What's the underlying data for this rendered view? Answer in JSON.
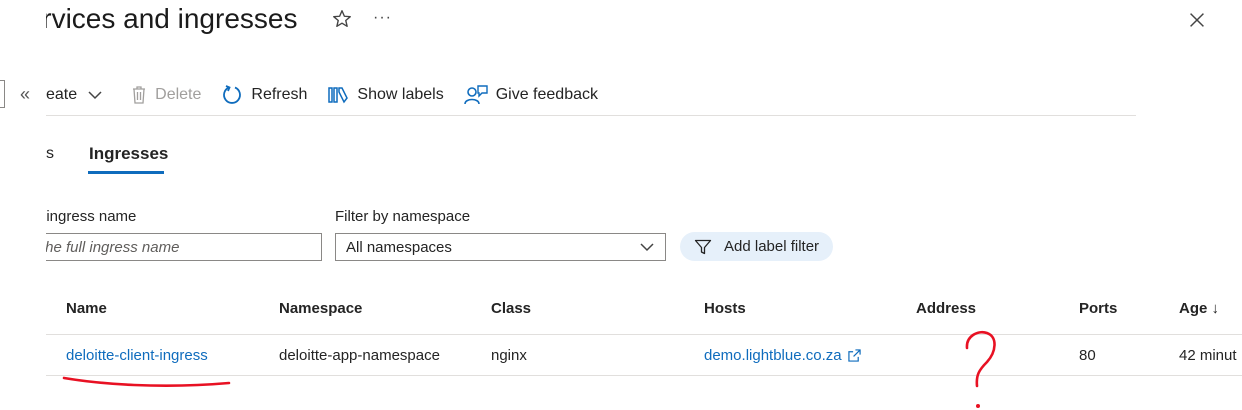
{
  "header": {
    "title": "Services and ingresses",
    "more_label": "···"
  },
  "toolbar": {
    "create_label": "eate",
    "delete_label": "Delete",
    "refresh_label": "Refresh",
    "show_labels_label": "Show labels",
    "feedback_label": "Give feedback"
  },
  "tabs": {
    "partial_label": "s",
    "active_label": "Ingresses"
  },
  "filters": {
    "name_label": "/ ingress name",
    "name_placeholder": "the full ingress name",
    "namespace_label": "Filter by namespace",
    "namespace_value": "All namespaces",
    "add_label_filter": "Add label filter"
  },
  "table": {
    "columns": [
      "Name",
      "Namespace",
      "Class",
      "Hosts",
      "Address",
      "Ports",
      "Age ↓"
    ],
    "rows": [
      {
        "name": "deloitte-client-ingress",
        "namespace": "deloitte-app-namespace",
        "class": "nginx",
        "hosts": "demo.lightblue.co.za",
        "address": "",
        "ports": "80",
        "age": "42 minut"
      }
    ]
  },
  "colors": {
    "accent": "#0f6cbd",
    "annotation": "#e81123"
  }
}
